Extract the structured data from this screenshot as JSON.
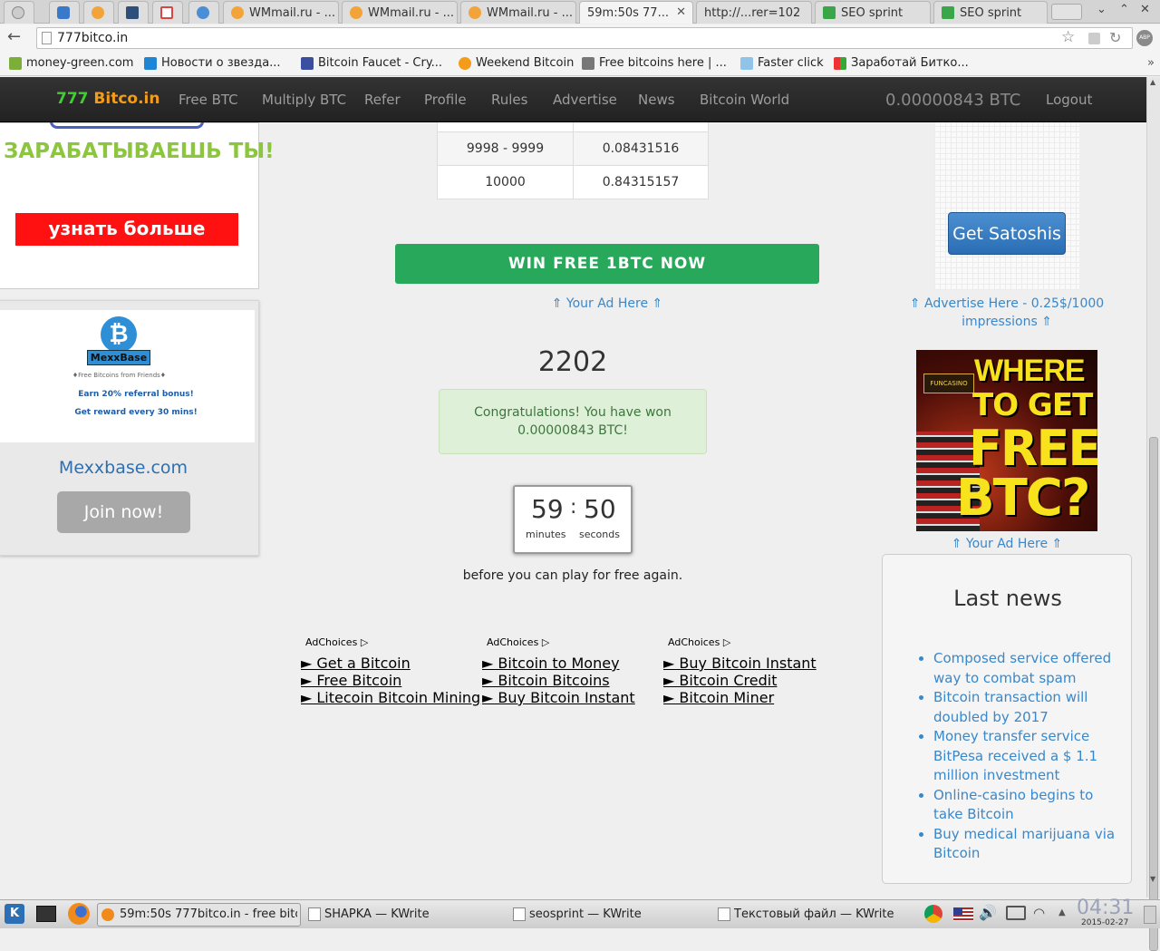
{
  "browser": {
    "tabs": [
      {
        "label": ""
      },
      {
        "label": ""
      },
      {
        "label": ""
      },
      {
        "label": ""
      },
      {
        "label": ""
      },
      {
        "label": "WMmail.ru - ..."
      },
      {
        "label": "WMmail.ru - ..."
      },
      {
        "label": "WMmail.ru - ..."
      },
      {
        "label": "59m:50s 77..."
      },
      {
        "label": "http://...rer=102"
      },
      {
        "label": "SEO sprint"
      },
      {
        "label": "SEO sprint"
      }
    ],
    "url": "777bitco.in",
    "bookmarks": [
      {
        "label": "money-green.com"
      },
      {
        "label": "Новости о звезда..."
      },
      {
        "label": "Bitcoin Faucet - Cry..."
      },
      {
        "label": "Weekend Bitcoin"
      },
      {
        "label": "Free bitcoins here | ..."
      },
      {
        "label": "Faster click"
      },
      {
        "label": "Заработай Битко..."
      }
    ],
    "ext_label": "ABP"
  },
  "site": {
    "logo_num": "777",
    "logo_text": "Bitco.in",
    "nav": [
      "Free BTC",
      "Multiply BTC",
      "Refer",
      "Profile",
      "Rules",
      "Advertise",
      "News",
      "Bitcoin World"
    ],
    "balance": "0.00000843 BTC",
    "logout": "Logout"
  },
  "left_ads": {
    "banner_heading": "ЗАРАБАТЫВАЕШЬ ТЫ!",
    "banner_button": "узнать больше",
    "mexx_logo": "MexxBase",
    "mexx_tag": "♦Free Bitcoins from Friends♦",
    "mexx_line1": "Earn 20% referral bonus!",
    "mexx_line2": "Get reward every 30 mins!",
    "mexx_site": "Mexxbase.com",
    "mexx_join": "Join now!"
  },
  "payout_table": [
    {
      "range": "9998 - 9999",
      "payout": "0.08431516"
    },
    {
      "range": "10000",
      "payout": "0.84315157"
    }
  ],
  "main": {
    "win_button": "WIN FREE 1BTC NOW",
    "ad_here": "⇑ Your Ad Here ⇑",
    "rolled_number": "2202",
    "congrats": "Congratulations! You have won 0.00000843 BTC!",
    "timer_minutes": "59",
    "timer_sep": ":",
    "timer_seconds": "50",
    "timer_minutes_label": "minutes",
    "timer_seconds_label": "seconds",
    "before_text": "before you can play for free again."
  },
  "adchoices": [
    {
      "label": "AdChoices",
      "links": [
        "► Get a Bitcoin",
        "► Free Bitcoin",
        "► Litecoin Bitcoin Mining"
      ]
    },
    {
      "label": "AdChoices",
      "links": [
        "► Bitcoin to Money",
        "► Bitcoin Bitcoins",
        "► Buy Bitcoin Instant"
      ]
    },
    {
      "label": "AdChoices",
      "links": [
        "► Buy Bitcoin Instant",
        "► Bitcoin Credit",
        "► Bitcoin Miner"
      ]
    }
  ],
  "right": {
    "get_satoshis": "Get Satoshis",
    "advertise_line1": "⇑ Advertise Here - 0.25$/1000",
    "advertise_line2": "impressions ⇑",
    "casino_brand": "FUNCASINO",
    "casino_line1": "WHERE",
    "casino_line2": "TO GET",
    "casino_line3": "FREE",
    "casino_line4": "BTC?",
    "ad_here": "⇑ Your Ad Here ⇑",
    "news_title": "Last news",
    "news": [
      "Composed service offered way to combat spam",
      "Bitcoin transaction will doubled by 2017",
      "Money transfer service BitPesa received a $ 1.1 million investment",
      "Online-casino begins to take Bitcoin",
      "Buy medical marijuana via Bitcoin"
    ]
  },
  "taskbar": {
    "items": [
      {
        "label": "59m:50s 777bitco.in - free bitc"
      },
      {
        "label": "SHAPKA — KWrite"
      },
      {
        "label": "seosprint — KWrite"
      },
      {
        "label": "Текстовый файл — KWrite"
      }
    ],
    "clock": "04:31",
    "date": "2015-02-27"
  }
}
